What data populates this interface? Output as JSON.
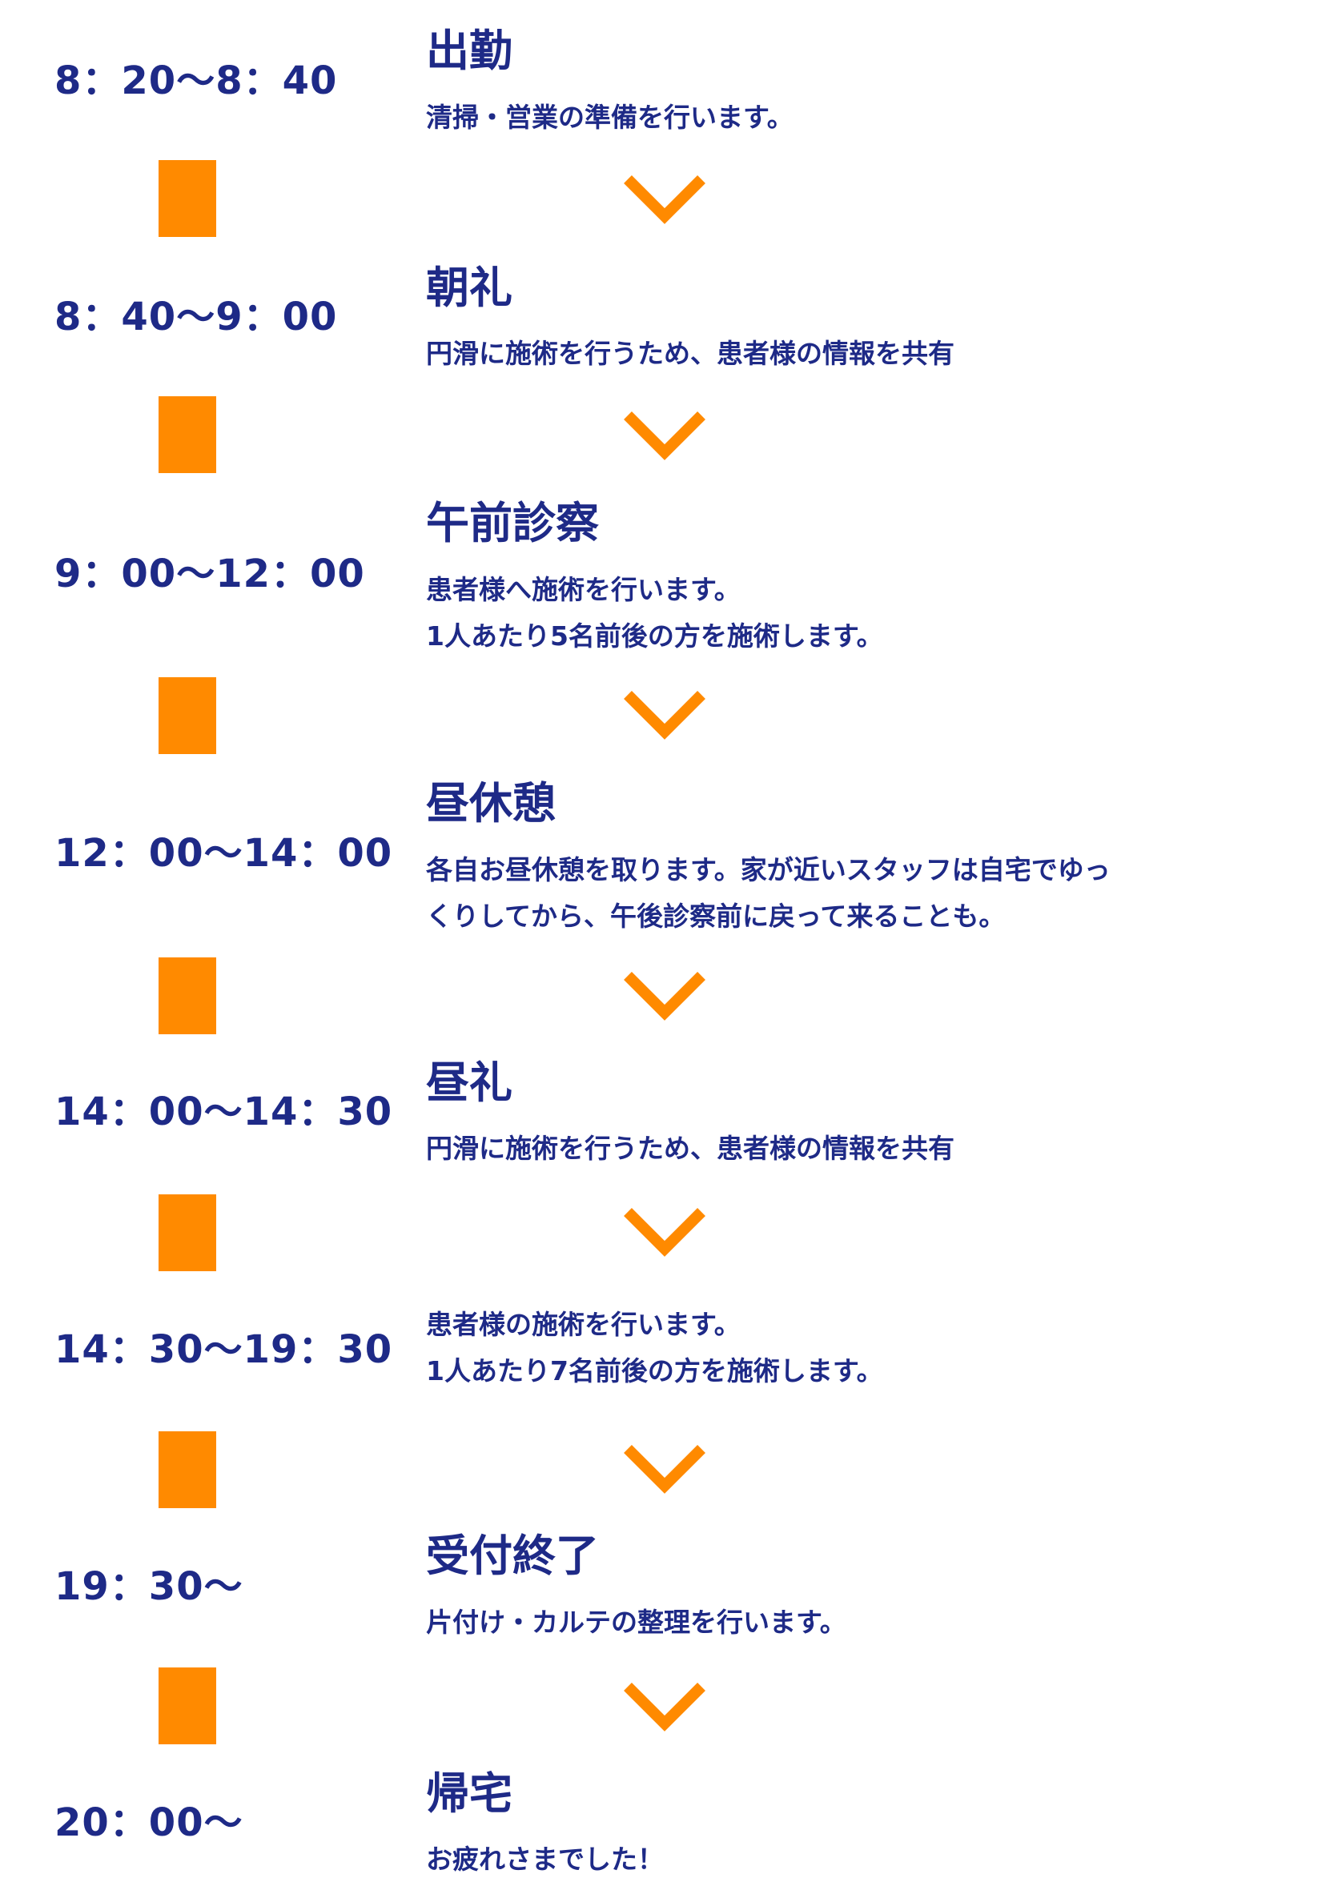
{
  "accent_color": "#ff8a00",
  "text_color": "#1e2a87",
  "connector_icon": "chevron-down-icon",
  "steps": [
    {
      "time": "8：20〜8：40",
      "title": "出勤",
      "desc": [
        "清掃・営業の準備を行います。"
      ]
    },
    {
      "time": "8：40〜9：00",
      "title": "朝礼",
      "desc": [
        "円滑に施術を行うため、患者様の情報を共有"
      ]
    },
    {
      "time": "9：00〜12：00",
      "title": "午前診察",
      "desc": [
        "患者様へ施術を行います。",
        "1人あたり5名前後の方を施術します。"
      ]
    },
    {
      "time": "12：00〜14：00",
      "title": "昼休憩",
      "desc": [
        "各自お昼休憩を取ります。家が近いスタッフは自宅でゆっ",
        "くりしてから、午後診察前に戻って来ることも。"
      ]
    },
    {
      "time": "14：00〜14：30",
      "title": "昼礼",
      "desc": [
        "円滑に施術を行うため、患者様の情報を共有"
      ]
    },
    {
      "time": "14：30〜19：30",
      "title": "",
      "desc": [
        "患者様の施術を行います。",
        "1人あたり7名前後の方を施術します。"
      ]
    },
    {
      "time": "19：30〜",
      "title": "受付終了",
      "desc": [
        "片付け・カルテの整理を行います。"
      ]
    },
    {
      "time": "20：00〜",
      "title": "帰宅",
      "desc": [
        "お疲れさまでした！"
      ]
    }
  ]
}
